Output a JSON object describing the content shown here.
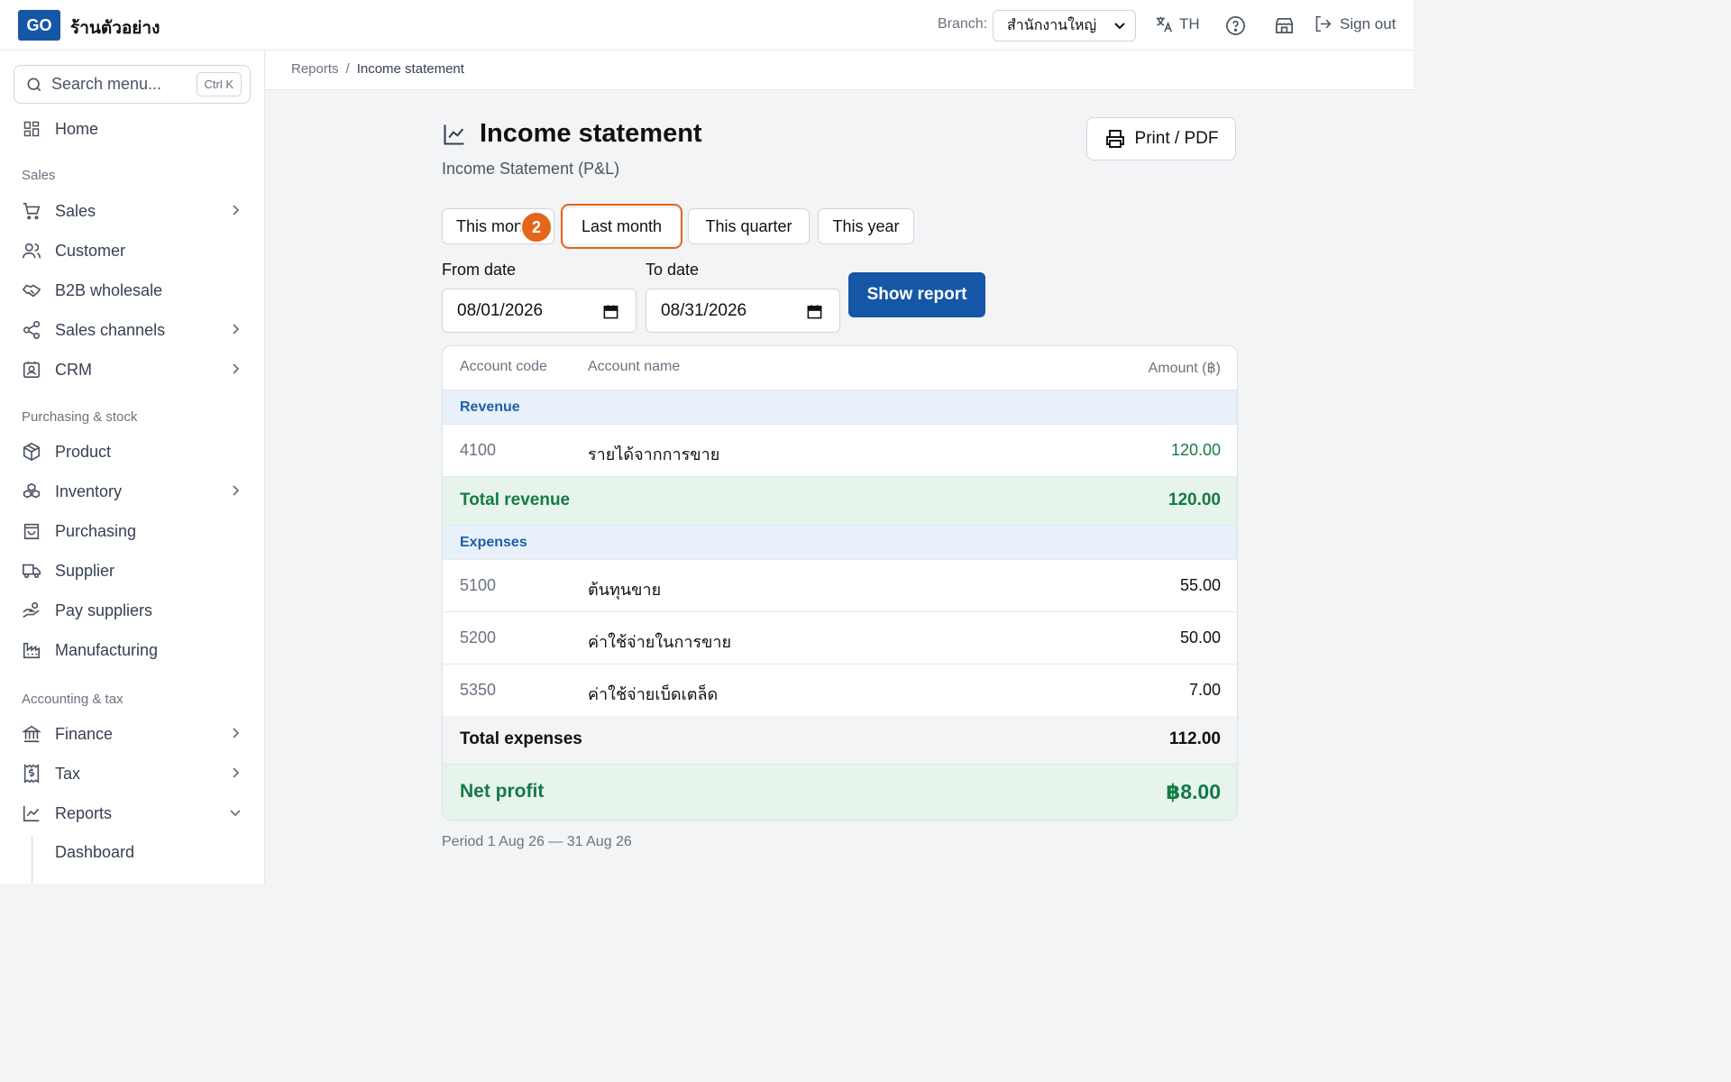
{
  "header": {
    "logo": "GO",
    "shop_name": "ร้านตัวอย่าง",
    "branch_label": "Branch:",
    "branch_value": "สำนักงานใหญ่",
    "lang": "TH",
    "sign_out": "Sign out"
  },
  "sidebar": {
    "search_placeholder": "Search menu...",
    "search_shortcut": "Ctrl K",
    "home": "Home",
    "sections": {
      "sales": "Sales",
      "purchasing": "Purchasing & stock",
      "accounting": "Accounting & tax"
    },
    "items": {
      "sales": "Sales",
      "customer": "Customer",
      "b2b": "B2B wholesale",
      "channels": "Sales channels",
      "crm": "CRM",
      "product": "Product",
      "inventory": "Inventory",
      "purchasing": "Purchasing",
      "supplier": "Supplier",
      "pay_suppliers": "Pay suppliers",
      "manufacturing": "Manufacturing",
      "finance": "Finance",
      "tax": "Tax",
      "reports": "Reports",
      "dashboard": "Dashboard"
    }
  },
  "breadcrumb": {
    "parent": "Reports",
    "sep": "/",
    "current": "Income statement"
  },
  "page": {
    "title": "Income statement",
    "subtitle": "Income Statement (P&L)",
    "print_label": "Print / PDF",
    "step_marker": "2",
    "presets": [
      "This month",
      "Last month",
      "This quarter",
      "This year"
    ],
    "from_label": "From date",
    "from_value": "08/01/2026",
    "to_label": "To date",
    "to_value": "08/31/2026",
    "show_button": "Show report",
    "period": "Period 1 Aug 26 — 31 Aug 26"
  },
  "table": {
    "headers": {
      "code": "Account code",
      "name": "Account name",
      "amount": "Amount (฿)"
    },
    "revenue_label": "Revenue",
    "revenue_rows": [
      {
        "code": "4100",
        "name": "รายได้จากการขาย",
        "amount": "120.00"
      }
    ],
    "total_revenue_label": "Total revenue",
    "total_revenue": "120.00",
    "expenses_label": "Expenses",
    "expense_rows": [
      {
        "code": "5100",
        "name": "ต้นทุนขาย",
        "amount": "55.00"
      },
      {
        "code": "5200",
        "name": "ค่าใช้จ่ายในการขาย",
        "amount": "50.00"
      },
      {
        "code": "5350",
        "name": "ค่าใช้จ่ายเบ็ดเตล็ด",
        "amount": "7.00"
      }
    ],
    "total_expenses_label": "Total expenses",
    "total_expenses": "112.00",
    "net_label": "Net profit",
    "net_value": "฿8.00"
  },
  "colors": {
    "brand": "#1557a6",
    "highlight": "#e4661b",
    "positive": "#157a45",
    "section_bg": "#e8f1fb"
  }
}
